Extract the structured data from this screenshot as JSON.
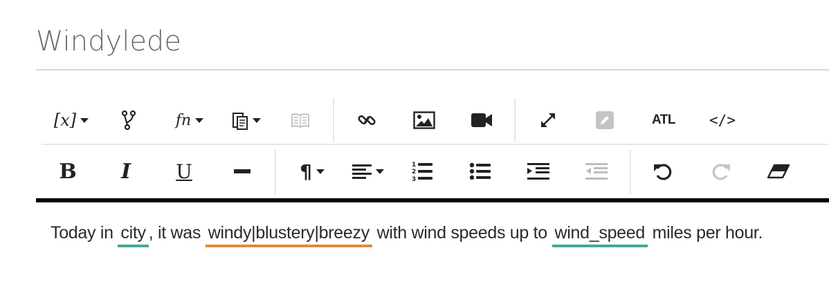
{
  "title": "Windylede",
  "toolbar": {
    "row1": [
      {
        "name": "variable-menu-button",
        "label": "[x]",
        "icon": "variable-icon",
        "dropdown": true
      },
      {
        "name": "branch-button",
        "icon": "branch-icon"
      },
      {
        "name": "function-menu-button",
        "label": "fn",
        "icon": "function-icon",
        "dropdown": true
      },
      {
        "name": "paste-menu-button",
        "icon": "clipboard-icon",
        "dropdown": true
      },
      {
        "name": "dictionary-button",
        "icon": "book-icon",
        "disabled": true
      },
      {
        "name": "link-button",
        "icon": "link-icon"
      },
      {
        "name": "image-button",
        "icon": "image-icon"
      },
      {
        "name": "video-button",
        "icon": "video-icon"
      },
      {
        "name": "fullscreen-button",
        "icon": "expand-icon"
      },
      {
        "name": "edit-button",
        "icon": "edit-icon",
        "disabled": true
      },
      {
        "name": "atl-button",
        "label": "ATL",
        "icon": "atl-icon"
      },
      {
        "name": "source-code-button",
        "label": "</>",
        "icon": "code-icon"
      }
    ],
    "row2": [
      {
        "name": "bold-button",
        "label": "B",
        "icon": "bold-icon"
      },
      {
        "name": "italic-button",
        "label": "I",
        "icon": "italic-icon"
      },
      {
        "name": "underline-button",
        "label": "U",
        "icon": "underline-icon"
      },
      {
        "name": "horizontal-rule-button",
        "icon": "horizontal-rule-icon"
      },
      {
        "name": "paragraph-menu-button",
        "label": "¶",
        "icon": "paragraph-icon",
        "dropdown": true
      },
      {
        "name": "align-menu-button",
        "icon": "align-left-icon",
        "dropdown": true
      },
      {
        "name": "ordered-list-button",
        "icon": "ordered-list-icon"
      },
      {
        "name": "bullet-list-button",
        "icon": "bullet-list-icon"
      },
      {
        "name": "indent-button",
        "icon": "indent-icon"
      },
      {
        "name": "outdent-button",
        "icon": "outdent-icon",
        "disabled": true
      },
      {
        "name": "undo-button",
        "icon": "undo-icon"
      },
      {
        "name": "redo-button",
        "icon": "redo-icon",
        "disabled": true
      },
      {
        "name": "clear-format-button",
        "icon": "eraser-icon"
      }
    ]
  },
  "content": {
    "parts": [
      {
        "type": "text",
        "value": "Today in "
      },
      {
        "type": "var",
        "value": "city",
        "color": "#4aa59a"
      },
      {
        "type": "text",
        "value": ", it was "
      },
      {
        "type": "var",
        "value": "windy|blustery|breezy",
        "color": "#e08a3c"
      },
      {
        "type": "text",
        "value": " with wind speeds up to "
      },
      {
        "type": "var",
        "value": "wind_speed",
        "color": "#4aa59a"
      },
      {
        "type": "text",
        "value": " miles per hour."
      }
    ]
  },
  "colors": {
    "variable_underline": "#4aa59a",
    "synonym_underline": "#e08a3c",
    "disabled_icon": "#bdbdbd",
    "title_text": "#6b6b6b"
  }
}
